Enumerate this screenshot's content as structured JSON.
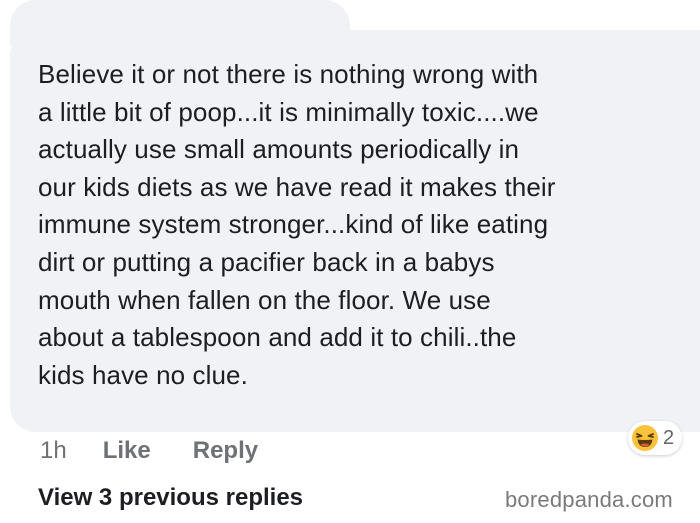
{
  "comment": {
    "lines": [
      "Believe it or not there is nothing wrong with",
      "a little bit of poop...it is minimally toxic....we",
      "actually use small amounts periodically in",
      "our kids diets as we have read it makes their",
      "immune system stronger...kind of like eating",
      "dirt or putting a pacifier back in a babys",
      "mouth when fallen on the floor.  We use",
      "about a tablespoon and add it to chili..the",
      "kids have no clue."
    ]
  },
  "actions": {
    "time": "1h",
    "like_label": "Like",
    "reply_label": "Reply"
  },
  "reaction": {
    "icon": "laughing-emoji-icon",
    "count": "2"
  },
  "replies": {
    "view_label": "View 3 previous replies"
  },
  "watermark": "boredpanda.com",
  "colors": {
    "bubble_background": "#f0f2f5",
    "meta_text": "#6e7176",
    "emoji_yellow": "#f7c33a"
  }
}
